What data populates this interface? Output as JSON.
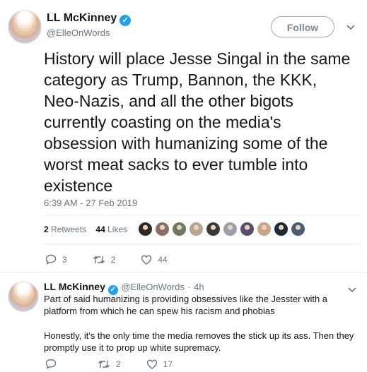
{
  "main_tweet": {
    "author_name": "LL McKinney",
    "author_handle": "@ElleOnWords",
    "follow_label": "Follow",
    "text": "History will place Jesse Singal in the same category as Trump, Bannon, the KKK, Neo-Nazis, and all the other bigots currently coasting on the media's obsession with humanizing some of the worst meat sacks to ever tumble into existence",
    "timestamp": "6:39 AM - 27 Feb 2019",
    "retweets_count": "2",
    "retweets_label": "Retweets",
    "likes_count": "44",
    "likes_label": "Likes",
    "actions": {
      "replies": "3",
      "retweets": "2",
      "likes": "44"
    },
    "liker_colors": [
      "#2b2b2b",
      "#8a6f62",
      "#6d7a5c",
      "#b8a48f",
      "#3a3a3a",
      "#9aa0a8",
      "#5a4d6e",
      "#c9a48a",
      "#1f2a36",
      "#4a5b73"
    ]
  },
  "reply_tweet": {
    "author_name": "LL McKinney",
    "author_handle": "@ElleOnWords",
    "age": "4h",
    "paragraph1": "Part of said humanizing is providing obsessives like the Jesster with a platform from which he can spew his racism and phobias",
    "paragraph2": "Honestly, it's the only time the media removes the stick up its ass. Then they promptly use it to prop up white supremacy.",
    "actions": {
      "replies": "",
      "retweets": "2",
      "likes": "17"
    }
  },
  "colors": {
    "accent": "#1da1f2",
    "muted": "#657786",
    "text": "#14171a",
    "border": "#e6ecf0"
  },
  "icons": [
    "verified-badge-icon",
    "chevron-down-icon",
    "reply-icon",
    "retweet-icon",
    "heart-icon"
  ]
}
